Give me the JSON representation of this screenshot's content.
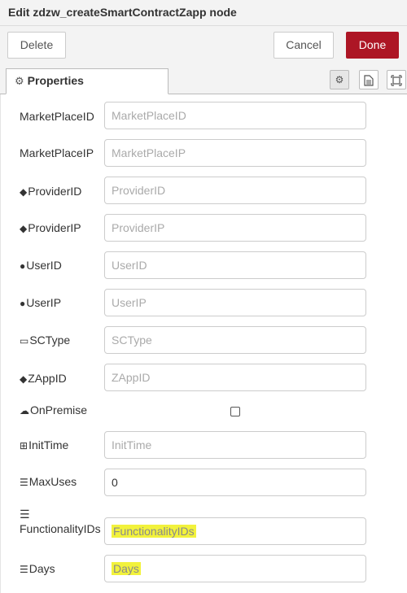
{
  "title": "Edit zdzw_createSmartContractZapp node",
  "toolbar": {
    "delete_label": "Delete",
    "cancel_label": "Cancel",
    "done_label": "Done"
  },
  "tabs": {
    "properties_label": "Properties"
  },
  "icons": {
    "tab_gear": "gear-icon",
    "tab_btn1": "gear-icon",
    "tab_btn2": "document-icon",
    "tab_btn3": "frame-icon"
  },
  "fields": {
    "marketplaceid": {
      "label": "MarketPlaceID",
      "placeholder": "MarketPlaceID"
    },
    "marketplaceip": {
      "label": "MarketPlaceIP",
      "placeholder": "MarketPlaceIP"
    },
    "providerid": {
      "label": "ProviderID",
      "placeholder": "ProviderID",
      "icon": "tag-icon"
    },
    "providerip": {
      "label": "ProviderIP",
      "placeholder": "ProviderIP",
      "icon": "tag-icon"
    },
    "userid": {
      "label": "UserID",
      "placeholder": "UserID",
      "icon": "user-icon"
    },
    "userip": {
      "label": "UserIP",
      "placeholder": "UserIP",
      "icon": "user-icon"
    },
    "sctype": {
      "label": "SCType",
      "placeholder": "SCType",
      "icon": "credit-card-icon"
    },
    "zappid": {
      "label": "ZAppID",
      "placeholder": "ZAppID",
      "icon": "tag-icon"
    },
    "onpremise": {
      "label": "OnPremise",
      "icon": "cloud-icon",
      "checked": false
    },
    "inittime": {
      "label": "InitTime",
      "placeholder": "InitTime",
      "icon": "calendar-plus-icon"
    },
    "maxuses": {
      "label": "MaxUses",
      "value": "0",
      "icon": "list-icon"
    },
    "functionalityids": {
      "label": "FunctionalityIDs",
      "placeholder": "FunctionalityIDs",
      "icon": "list-icon"
    },
    "days": {
      "label": "Days",
      "placeholder": "Days",
      "icon": "list-icon"
    }
  },
  "colors": {
    "done_bg": "#ad1625",
    "highlight": "#f2f23c"
  }
}
